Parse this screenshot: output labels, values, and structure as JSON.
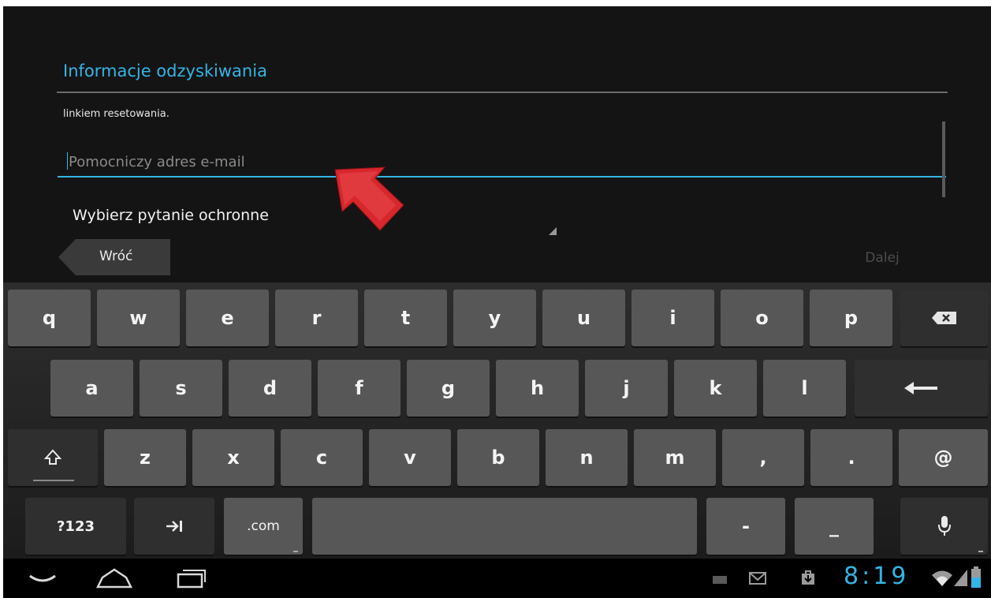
{
  "screen": {
    "title": "Informacje odzyskiwania",
    "helper_text": "linkiem resetowania.",
    "email_placeholder": "Pomocniczy adres e-mail",
    "security_question_label": "Wybierz pytanie ochronne",
    "back_label": "Wróć",
    "next_label": "Dalej"
  },
  "keyboard": {
    "row1": [
      "q",
      "w",
      "e",
      "r",
      "t",
      "y",
      "u",
      "i",
      "o",
      "p"
    ],
    "row2": [
      "a",
      "s",
      "d",
      "f",
      "g",
      "h",
      "j",
      "k",
      "l"
    ],
    "row3": [
      "z",
      "x",
      "c",
      "v",
      "b",
      "n",
      "m",
      ",",
      "."
    ],
    "at": "@",
    "symbols": "?123",
    "dotcom": ".com",
    "dash": "-",
    "underscore": "_"
  },
  "status": {
    "time": "8:19"
  },
  "colors": {
    "accent": "#33b5e5",
    "background": "#141414",
    "key": "#575757",
    "key_function": "#2f2f2f",
    "pointer_arrow": "#d7262c"
  },
  "icons": [
    "backspace-icon",
    "enter-icon",
    "shift-icon",
    "tab-icon",
    "microphone-icon",
    "back-nav-icon",
    "home-nav-icon",
    "recent-apps-icon",
    "keyboard-status-icon",
    "gmail-icon",
    "download-icon",
    "wifi-icon",
    "signal-icon",
    "battery-icon"
  ]
}
